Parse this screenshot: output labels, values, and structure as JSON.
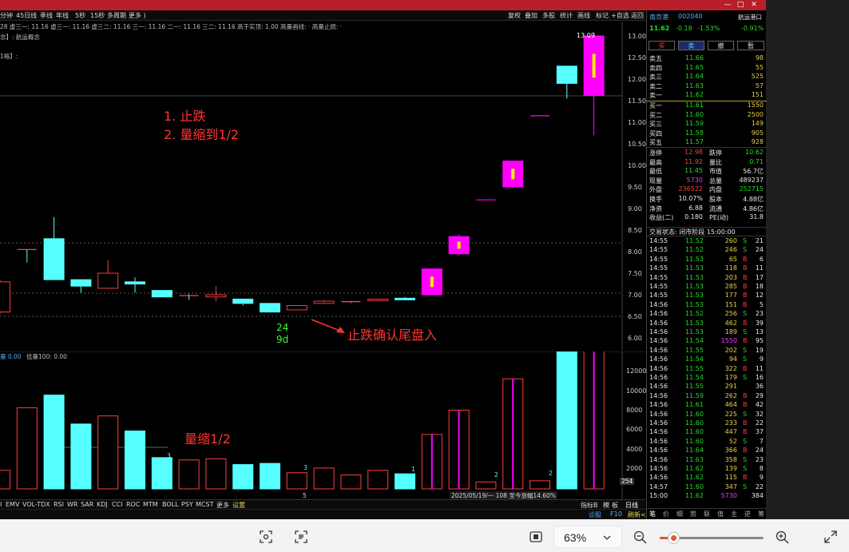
{
  "titlebar": {
    "controls": [
      "—",
      "□",
      "✕"
    ]
  },
  "periods": [
    "分钟",
    "45日线",
    "季线",
    "年线",
    "5秒",
    "15秒",
    "多周期",
    "更多 )"
  ],
  "toolbar": [
    "复权",
    "叠加",
    "多股",
    "统计",
    "画线",
    "标记",
    "+自选",
    "返回"
  ],
  "ma_line": "28 虚三一: 11.16 虚三一: 11.16 虚三二: 11.16 三一: 11.16 二一: 11.16 三二: 11.16 高于实顶: 1.00 高量画线: · 高量止损: ·",
  "concept_line": "念】: 航运概念",
  "concept_line2": "1格】:",
  "price_axis": [
    "13.00",
    "12.50",
    "12.00",
    "11.50",
    "11.00",
    "10.50",
    "10.00",
    "9.50",
    "9.00",
    "8.50",
    "8.00",
    "7.50",
    "7.00",
    "6.50",
    "6.00"
  ],
  "high_label": "13.09",
  "annotations": {
    "line1": "1.   止跌",
    "line2": "2.  量缩到1/2",
    "arrow_text": "止跌确认尾盘入",
    "vol_text": "量缩1/2",
    "count1": "24",
    "count2": "9d"
  },
  "vol_header_a": "量 0.00",
  "vol_header_b": "低量100: 0.00",
  "vol_axis": [
    "12000",
    "10000",
    "8000",
    "6000",
    "4000",
    "2000"
  ],
  "vol_side": "254",
  "vol_markers": [
    "3",
    "3",
    "1",
    "2",
    "2"
  ],
  "vol_footer": "5",
  "vol_range": "2025/05/19/一 108 至今涨幅14.60%",
  "chart_data": {
    "type": "candlestick",
    "candles": [
      {
        "o": 6.6,
        "h": 7.35,
        "l": 6.55,
        "c": 7.3,
        "up": true
      },
      {
        "o": 8.05,
        "h": 8.05,
        "l": 7.75,
        "c": 8.05,
        "up": false,
        "cross": true
      },
      {
        "o": 7.35,
        "h": 8.8,
        "l": 7.35,
        "c": 8.3,
        "up": false
      },
      {
        "o": 7.2,
        "h": 7.35,
        "l": 7.05,
        "c": 7.35,
        "up": false
      },
      {
        "o": 7.15,
        "h": 7.8,
        "l": 7.15,
        "c": 7.5,
        "up": true
      },
      {
        "o": 7.25,
        "h": 7.4,
        "l": 7.05,
        "c": 7.3,
        "up": false
      },
      {
        "o": 6.95,
        "h": 7.1,
        "l": 6.95,
        "c": 7.1,
        "up": false
      },
      {
        "o": 6.98,
        "h": 7.02,
        "l": 6.88,
        "c": 6.98,
        "up": false,
        "cross": true
      },
      {
        "o": 7.0,
        "h": 7.2,
        "l": 6.85,
        "c": 6.95,
        "up": true
      },
      {
        "o": 6.8,
        "h": 6.9,
        "l": 6.75,
        "c": 6.9,
        "up": false
      },
      {
        "o": 6.6,
        "h": 6.8,
        "l": 6.6,
        "c": 6.8,
        "up": false
      },
      {
        "o": 6.65,
        "h": 6.75,
        "l": 6.65,
        "c": 6.75,
        "up": true
      },
      {
        "o": 6.8,
        "h": 6.88,
        "l": 6.78,
        "c": 6.85,
        "up": true
      },
      {
        "o": 6.84,
        "h": 6.86,
        "l": 6.8,
        "c": 6.84,
        "up": true,
        "cross": true
      },
      {
        "o": 6.88,
        "h": 6.91,
        "l": 6.86,
        "c": 6.9,
        "up": true
      },
      {
        "o": 6.9,
        "h": 6.95,
        "l": 6.88,
        "c": 6.92,
        "up": false
      },
      {
        "o": 7.0,
        "h": 7.6,
        "l": 7.0,
        "c": 7.6,
        "up": true,
        "limit": true
      },
      {
        "o": 7.95,
        "h": 8.4,
        "l": 7.9,
        "c": 8.35,
        "up": true,
        "limit": true
      },
      {
        "o": 9.2,
        "h": 9.2,
        "l": 9.2,
        "c": 9.2,
        "up": true,
        "flat": true
      },
      {
        "o": 9.5,
        "h": 10.1,
        "l": 9.5,
        "c": 10.1,
        "up": true,
        "limit": true
      },
      {
        "o": 11.15,
        "h": 11.15,
        "l": 11.15,
        "c": 11.15,
        "up": true,
        "flat": true
      },
      {
        "o": 12.3,
        "h": 12.3,
        "l": 11.55,
        "c": 11.9,
        "up": false
      },
      {
        "o": 13.0,
        "h": 13.09,
        "l": 10.7,
        "c": 11.62,
        "up": true,
        "limit": true
      }
    ],
    "ylim": [
      5.9,
      13.2
    ],
    "volumes": [
      1600,
      7000,
      8100,
      5600,
      6300,
      5000,
      2700,
      2500,
      2600,
      2100,
      2200,
      1400,
      1800,
      1200,
      1600,
      1300,
      4700,
      6800,
      600,
      9500,
      700,
      12500,
      12500
    ],
    "vol_up": [
      true,
      true,
      false,
      false,
      true,
      false,
      false,
      true,
      true,
      false,
      false,
      true,
      true,
      true,
      true,
      false,
      true,
      true,
      true,
      true,
      true,
      false,
      true
    ],
    "vol_ylim": [
      0,
      13000
    ]
  },
  "stock": {
    "name": "南京港",
    "code": "002040",
    "sector": "航运港口",
    "price": "11.62",
    "change": "-0.18",
    "pct": "-1.53%",
    "sector_pct": "-0.91%",
    "buttons": [
      "买",
      "卖",
      "撤",
      "暂"
    ]
  },
  "asks": [
    {
      "label": "卖五",
      "price": "11.66",
      "vol": "98"
    },
    {
      "label": "卖四",
      "price": "11.65",
      "vol": "55"
    },
    {
      "label": "卖三",
      "price": "11.64",
      "vol": "525"
    },
    {
      "label": "卖二",
      "price": "11.63",
      "vol": "57"
    },
    {
      "label": "卖一",
      "price": "11.62",
      "vol": "151"
    }
  ],
  "bids": [
    {
      "label": "买一",
      "price": "11.61",
      "vol": "1550"
    },
    {
      "label": "买二",
      "price": "11.60",
      "vol": "2500"
    },
    {
      "label": "买三",
      "price": "11.59",
      "vol": "149"
    },
    {
      "label": "买四",
      "price": "11.58",
      "vol": "905"
    },
    {
      "label": "买五",
      "price": "11.57",
      "vol": "928"
    }
  ],
  "stats": [
    [
      "涨停",
      "12.98",
      "跌停",
      "10.62"
    ],
    [
      "最高",
      "11.92",
      "量比",
      "0.71"
    ],
    [
      "最低",
      "11.45",
      "市值",
      "56.7亿"
    ],
    [
      "现量",
      "5730",
      "总量",
      "489237"
    ],
    [
      "外盘",
      "236522",
      "内盘",
      "252715"
    ],
    [
      "换手",
      "10.07%",
      "股本",
      "4.88亿"
    ],
    [
      "净资",
      "6.88",
      "流通",
      "4.86亿"
    ],
    [
      "收益(二)",
      "0.180",
      "PE(动)",
      "31.8"
    ]
  ],
  "trade_status": "交易状态: 闭市阶段 15:00:00",
  "ticks": [
    [
      "14:55",
      "11.52",
      "260",
      "S",
      "21"
    ],
    [
      "14:55",
      "11.52",
      "246",
      "S",
      "24"
    ],
    [
      "14:55",
      "11.53",
      "65",
      "B",
      "6"
    ],
    [
      "14:55",
      "11.53",
      "118",
      "B",
      "11"
    ],
    [
      "14:55",
      "11.53",
      "203",
      "B",
      "17"
    ],
    [
      "14:55",
      "11.53",
      "285",
      "B",
      "18"
    ],
    [
      "14:55",
      "11.53",
      "177",
      "B",
      "12"
    ],
    [
      "14:56",
      "11.53",
      "151",
      "B",
      "5"
    ],
    [
      "14:56",
      "11.52",
      "256",
      "S",
      "23"
    ],
    [
      "14:56",
      "11.53",
      "462",
      "B",
      "39"
    ],
    [
      "14:56",
      "11.53",
      "189",
      "S",
      "13"
    ],
    [
      "14:56",
      "11.54",
      "1550",
      "B",
      "95"
    ],
    [
      "14:56",
      "11.55",
      "202",
      "S",
      "19"
    ],
    [
      "14:56",
      "11.54",
      "94",
      "S",
      "9"
    ],
    [
      "14:56",
      "11.55",
      "322",
      "B",
      "11"
    ],
    [
      "14:56",
      "11.54",
      "179",
      "S",
      "16"
    ],
    [
      "14:56",
      "11.55",
      "291",
      "",
      "36"
    ],
    [
      "14:56",
      "11.59",
      "262",
      "B",
      "29"
    ],
    [
      "14:56",
      "11.61",
      "464",
      "B",
      "42"
    ],
    [
      "14:56",
      "11.60",
      "225",
      "S",
      "32"
    ],
    [
      "14:56",
      "11.60",
      "233",
      "B",
      "22"
    ],
    [
      "14:56",
      "11.60",
      "447",
      "B",
      "37"
    ],
    [
      "14:56",
      "11.60",
      "52",
      "S",
      "7"
    ],
    [
      "14:56",
      "11.64",
      "366",
      "B",
      "24"
    ],
    [
      "14:56",
      "11.63",
      "358",
      "S",
      "23"
    ],
    [
      "14:56",
      "11.62",
      "139",
      "S",
      "8"
    ],
    [
      "14:56",
      "11.62",
      "115",
      "B",
      "9"
    ],
    [
      "14:57",
      "11.60",
      "347",
      "S",
      "22"
    ],
    [
      "15:00",
      "11.62",
      "5730",
      "",
      "384"
    ]
  ],
  "indicators": [
    "I",
    "EMV",
    "VOL-TDX",
    "RSI",
    "WR",
    "SAR",
    "KDJ",
    "CCI",
    "ROC",
    "MTM",
    "BOLL",
    "PSY",
    "MCST",
    "更多",
    "设置"
  ],
  "indicator_right": [
    "指标B",
    "模",
    "板",
    "日线"
  ],
  "right_tabs": [
    "笔",
    "价",
    "细",
    "势",
    "联",
    "值",
    "主",
    "逆",
    "筹"
  ],
  "status_right": [
    "诊股",
    "F10",
    "刷新<"
  ],
  "viewer": {
    "zoom": "63%"
  }
}
